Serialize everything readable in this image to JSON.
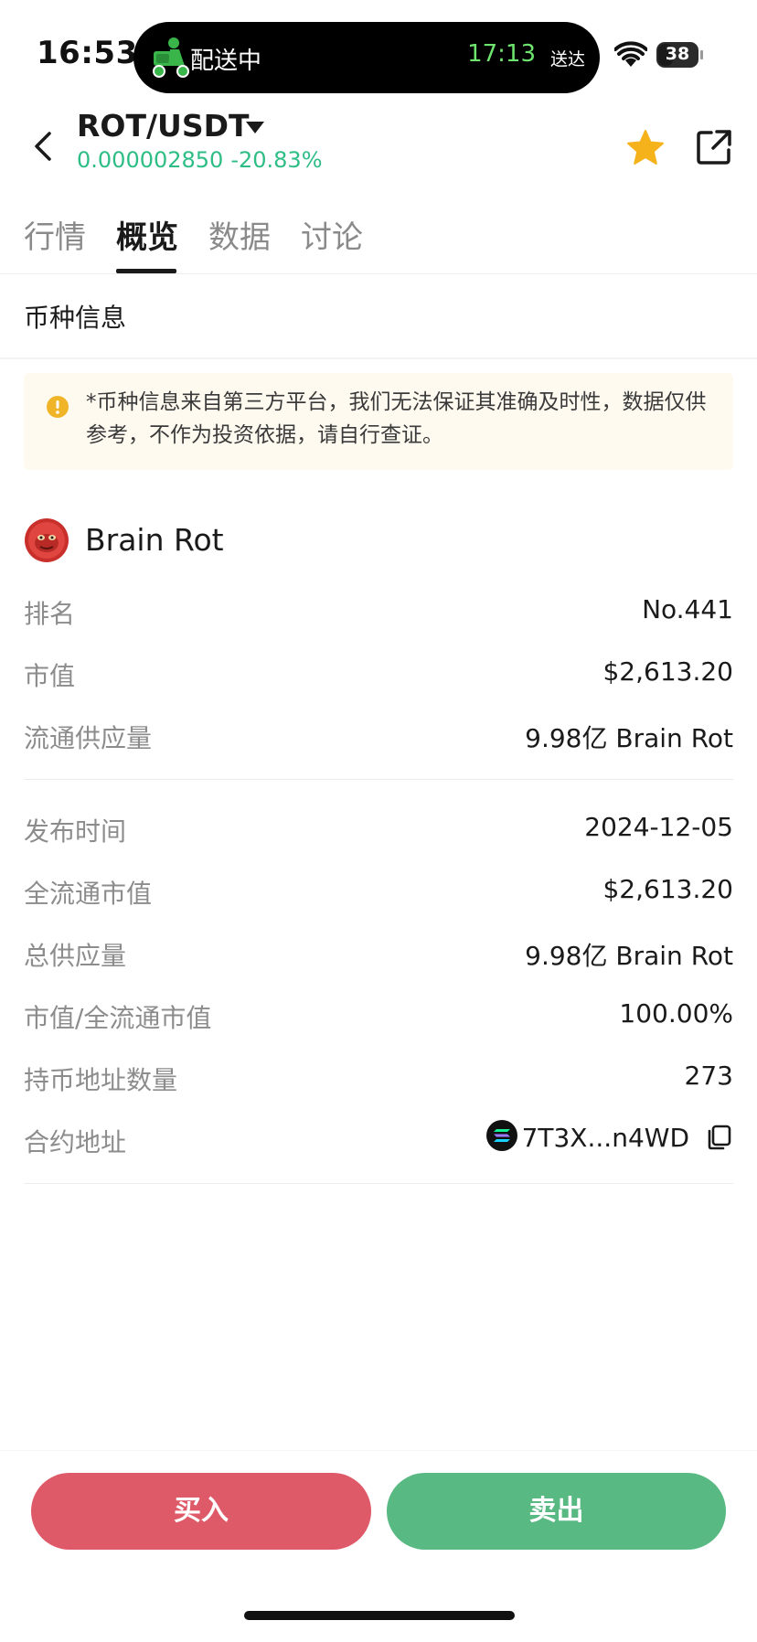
{
  "status_bar": {
    "time": "16:53",
    "live_activity_label": "配送中",
    "live_activity_eta": "17:13",
    "live_activity_eta_suffix": "送达",
    "battery": "38",
    "battery_level_percent": 38
  },
  "header": {
    "pair": "ROT/USDT",
    "price": "0.000002850",
    "change": "-20.83%",
    "price_color": "#2ebd85",
    "favorite_color": "#f5b21b"
  },
  "tabs": [
    {
      "label": "行情",
      "active": false
    },
    {
      "label": "概览",
      "active": true
    },
    {
      "label": "数据",
      "active": false
    },
    {
      "label": "讨论",
      "active": false
    }
  ],
  "section_title": "币种信息",
  "notice": "*币种信息来自第三方平台，我们无法保证其准确及时性，数据仅供参考，不作为投资依据，请自行查证。",
  "coin": {
    "name": "Brain Rot"
  },
  "stats_group1": [
    {
      "label": "排名",
      "value": "No.441"
    },
    {
      "label": "市值",
      "value": "$2,613.20"
    },
    {
      "label": "流通供应量",
      "value": "9.98亿 Brain Rot"
    }
  ],
  "stats_group2": [
    {
      "label": "发布时间",
      "value": "2024-12-05"
    },
    {
      "label": "全流通市值",
      "value": "$2,613.20"
    },
    {
      "label": "总供应量",
      "value": "9.98亿 Brain Rot"
    },
    {
      "label": "市值/全流通市值",
      "value": "100.00%"
    },
    {
      "label": "持币地址数量",
      "value": "273"
    }
  ],
  "contract": {
    "label": "合约地址",
    "value": "7T3X...n4WD"
  },
  "actions": {
    "buy_label": "买入",
    "sell_label": "卖出",
    "buy_color": "#df5a68",
    "sell_color": "#58b983"
  }
}
